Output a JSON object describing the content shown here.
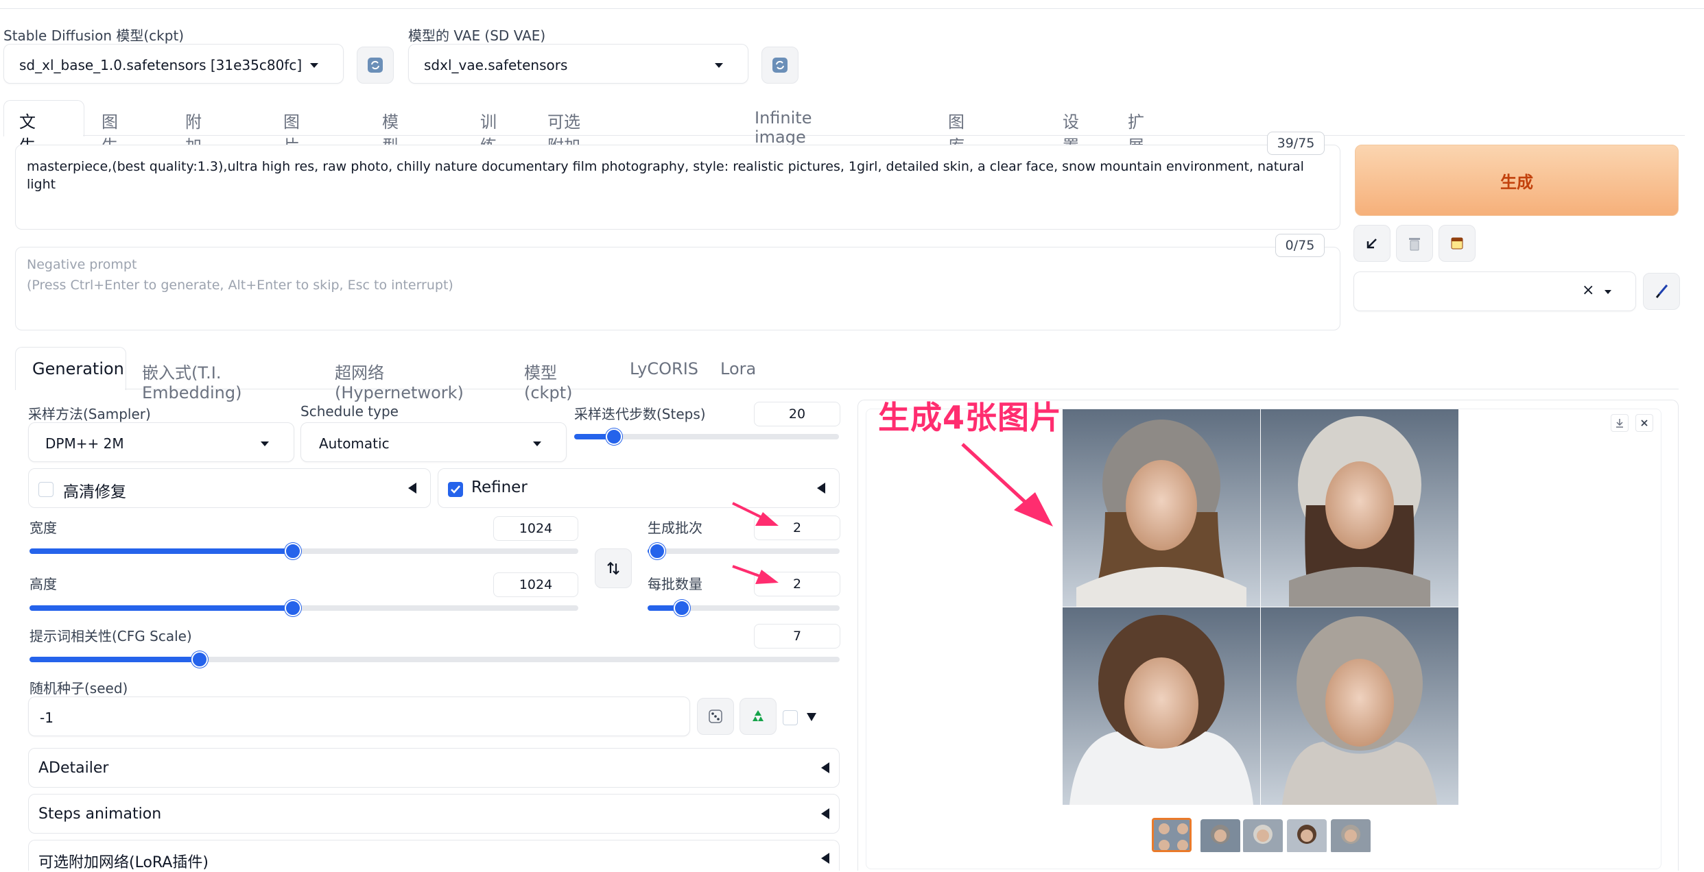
{
  "top": {
    "model_label": "Stable Diffusion 模型(ckpt)",
    "model_value": "sd_xl_base_1.0.safetensors [31e35c80fc]",
    "vae_label": "模型的 VAE (SD VAE)",
    "vae_value": "sdxl_vae.safetensors",
    "refresh_icon": "refresh-icon"
  },
  "main_tabs": [
    "文生图",
    "图生图",
    "附加功能",
    "图片信息",
    "模型合并",
    "训练",
    "可选附加网络(LoRA插件)",
    "Infinite image browsing",
    "图库浏览器",
    "设置",
    "扩展"
  ],
  "prompt": {
    "text": "masterpiece,(best quality:1.3),ultra high res, raw photo, chilly nature documentary film photography, style: realistic pictures, 1girl, detailed skin, a clear face, snow mountain environment, natural light",
    "counter": "39/75"
  },
  "negative_prompt": {
    "placeholder_line1": "Negative prompt",
    "placeholder_line2": "(Press Ctrl+Enter to generate, Alt+Enter to skip, Esc to interrupt)",
    "counter": "0/75"
  },
  "generate_button": "生成",
  "tool_icons": [
    "arrow-down-left-icon",
    "trash-icon",
    "clipboard-icon",
    "paintbrush-icon"
  ],
  "style_select": {
    "value": "",
    "clear_icon": "×"
  },
  "sub_tabs": [
    "Generation",
    "嵌入式(T.I. Embedding)",
    "超网络(Hypernetwork)",
    "模型(ckpt)",
    "LyCORIS",
    "Lora"
  ],
  "generation": {
    "sampler_label": "采样方法(Sampler)",
    "sampler_value": "DPM++ 2M",
    "schedule_label": "Schedule type",
    "schedule_value": "Automatic",
    "steps_label": "采样迭代步数(Steps)",
    "steps_value": "20",
    "steps_fraction": 0.15,
    "hires_label": "高清修复",
    "hires_checked": false,
    "refiner_label": "Refiner",
    "refiner_checked": true,
    "width_label": "宽度",
    "width_value": "1024",
    "width_fraction": 0.48,
    "height_label": "高度",
    "height_value": "1024",
    "height_fraction": 0.48,
    "batch_count_label": "生成批次",
    "batch_count_value": "2",
    "batch_count_fraction": 0.05,
    "batch_size_label": "每批数量",
    "batch_size_value": "2",
    "batch_size_fraction": 0.18,
    "cfg_label": "提示词相关性(CFG Scale)",
    "cfg_value": "7",
    "cfg_fraction": 0.21,
    "seed_label": "随机种子(seed)",
    "seed_value": "-1"
  },
  "accordions": [
    "ADetailer",
    "Steps animation",
    "可选附加网络(LoRA插件)"
  ],
  "annotation": {
    "text": "生成4张图片",
    "color": "#ff2d6f"
  },
  "colors": {
    "accent_blue": "#2563eb",
    "generate_orange": "#c2410c"
  }
}
